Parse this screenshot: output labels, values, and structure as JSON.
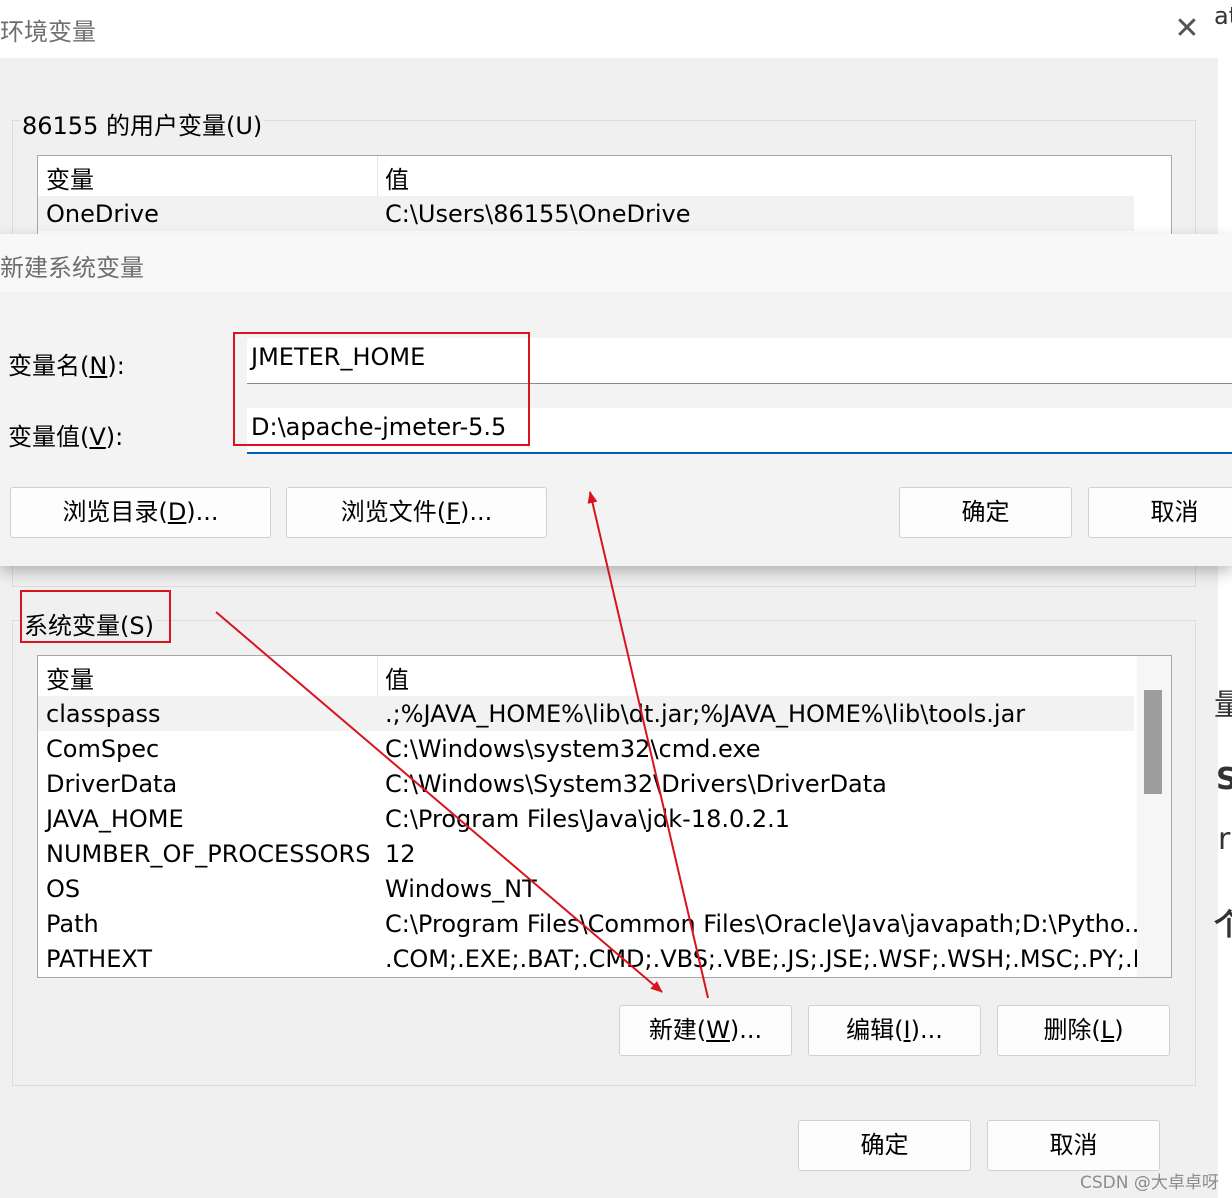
{
  "env_dialog": {
    "title": "环境变量",
    "close_glyph": "✕",
    "user_group_label": "86155 的用户变量(U)",
    "user_table": {
      "headers": [
        "变量",
        "值"
      ],
      "rows": [
        {
          "name": "OneDrive",
          "value": "C:\\Users\\86155\\OneDrive"
        }
      ]
    },
    "system_group_label": "系统变量(S)",
    "system_table": {
      "headers": [
        "变量",
        "值"
      ],
      "rows": [
        {
          "name": "classpass",
          "value": ".;%JAVA_HOME%\\lib\\dt.jar;%JAVA_HOME%\\lib\\tools.jar"
        },
        {
          "name": "ComSpec",
          "value": "C:\\Windows\\system32\\cmd.exe"
        },
        {
          "name": "DriverData",
          "value": "C:\\Windows\\System32\\Drivers\\DriverData"
        },
        {
          "name": "JAVA_HOME",
          "value": "C:\\Program Files\\Java\\jdk-18.0.2.1"
        },
        {
          "name": "NUMBER_OF_PROCESSORS",
          "value": "12"
        },
        {
          "name": "OS",
          "value": "Windows_NT"
        },
        {
          "name": "Path",
          "value": "C:\\Program Files\\Common Files\\Oracle\\Java\\javapath;D:\\Pytho..."
        },
        {
          "name": "PATHEXT",
          "value": ".COM;.EXE;.BAT;.CMD;.VBS;.VBE;.JS;.JSE;.WSF;.WSH;.MSC;.PY;.PY..."
        }
      ]
    },
    "system_buttons": {
      "new": {
        "pre": "新建(",
        "key": "W",
        "post": ")..."
      },
      "edit": {
        "pre": "编辑(",
        "key": "I",
        "post": ")..."
      },
      "delete": {
        "pre": "删除(",
        "key": "L",
        "post": ")"
      }
    },
    "ok": "确定",
    "cancel": "取消"
  },
  "new_var_dialog": {
    "title": "新建系统变量",
    "name_label": {
      "pre": "变量名(",
      "key": "N",
      "post": "):"
    },
    "value_label": {
      "pre": "变量值(",
      "key": "V",
      "post": "):"
    },
    "name_value": "JMETER_HOME",
    "value_value": "D:\\apache-jmeter-5.5",
    "browse_dir": {
      "pre": "浏览目录(",
      "key": "D",
      "post": ")..."
    },
    "browse_file": {
      "pre": "浏览文件(",
      "key": "F",
      "post": ")..."
    },
    "ok": "确定",
    "cancel": "取消"
  },
  "background_edge": {
    "top_fragment": "at",
    "side_fragments": [
      "量",
      "S",
      "r",
      "个"
    ]
  },
  "watermark": "CSDN @大卓卓呀",
  "colors": {
    "annotation_red": "#d9141e",
    "focus_underline": "#005fb8"
  }
}
